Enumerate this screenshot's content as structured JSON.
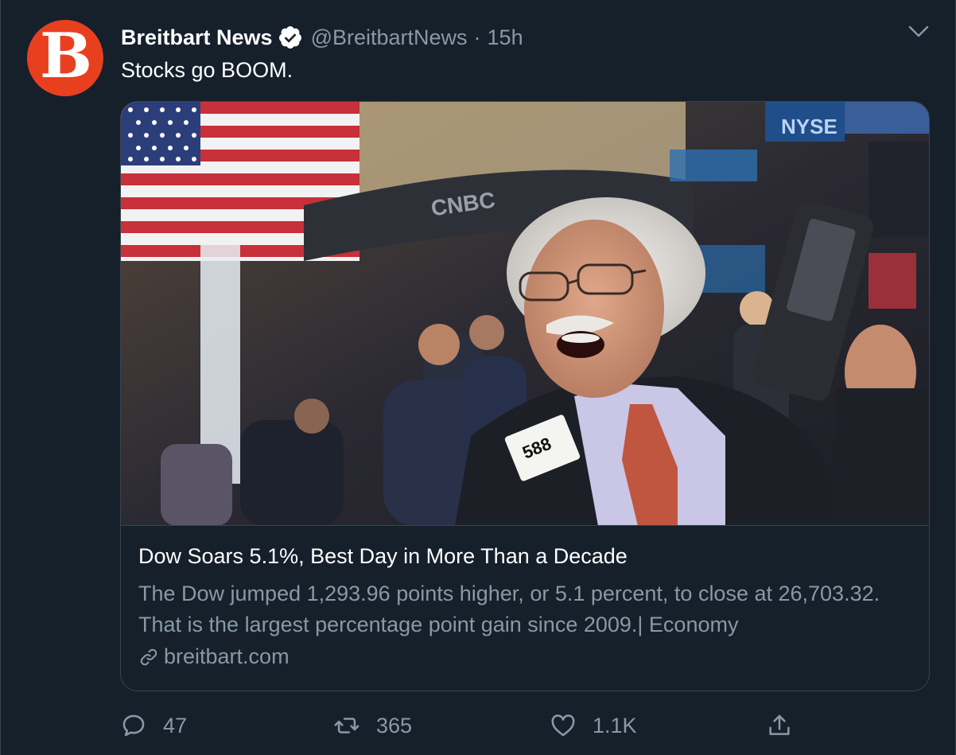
{
  "tweet": {
    "author_name": "Breitbart News",
    "avatar_letter": "B",
    "handle": "@BreitbartNews",
    "separator": "·",
    "time": "15h",
    "text": "Stocks go BOOM.",
    "verified": true
  },
  "card": {
    "title": "Dow Soars 5.1%, Best Day in More Than a Decade",
    "description": "The Dow jumped 1,293.96 points higher, or 5.1 percent, to close at 26,703.32. That is the largest percentage point gain since 2009.| Economy",
    "domain": "breitbart.com",
    "photo_badge": "588",
    "photo_signage": [
      "CNBC",
      "NYSE"
    ]
  },
  "actions": {
    "replies": "47",
    "retweets": "365",
    "likes": "1.1K"
  },
  "colors": {
    "background": "#15202b",
    "border": "#38444d",
    "secondary_text": "#8899a6",
    "avatar": "#e8401e",
    "verified": "#ffffff"
  },
  "icons": [
    "verified-badge-icon",
    "chevron-down-icon",
    "link-icon",
    "reply-icon",
    "retweet-icon",
    "like-icon",
    "share-icon"
  ]
}
